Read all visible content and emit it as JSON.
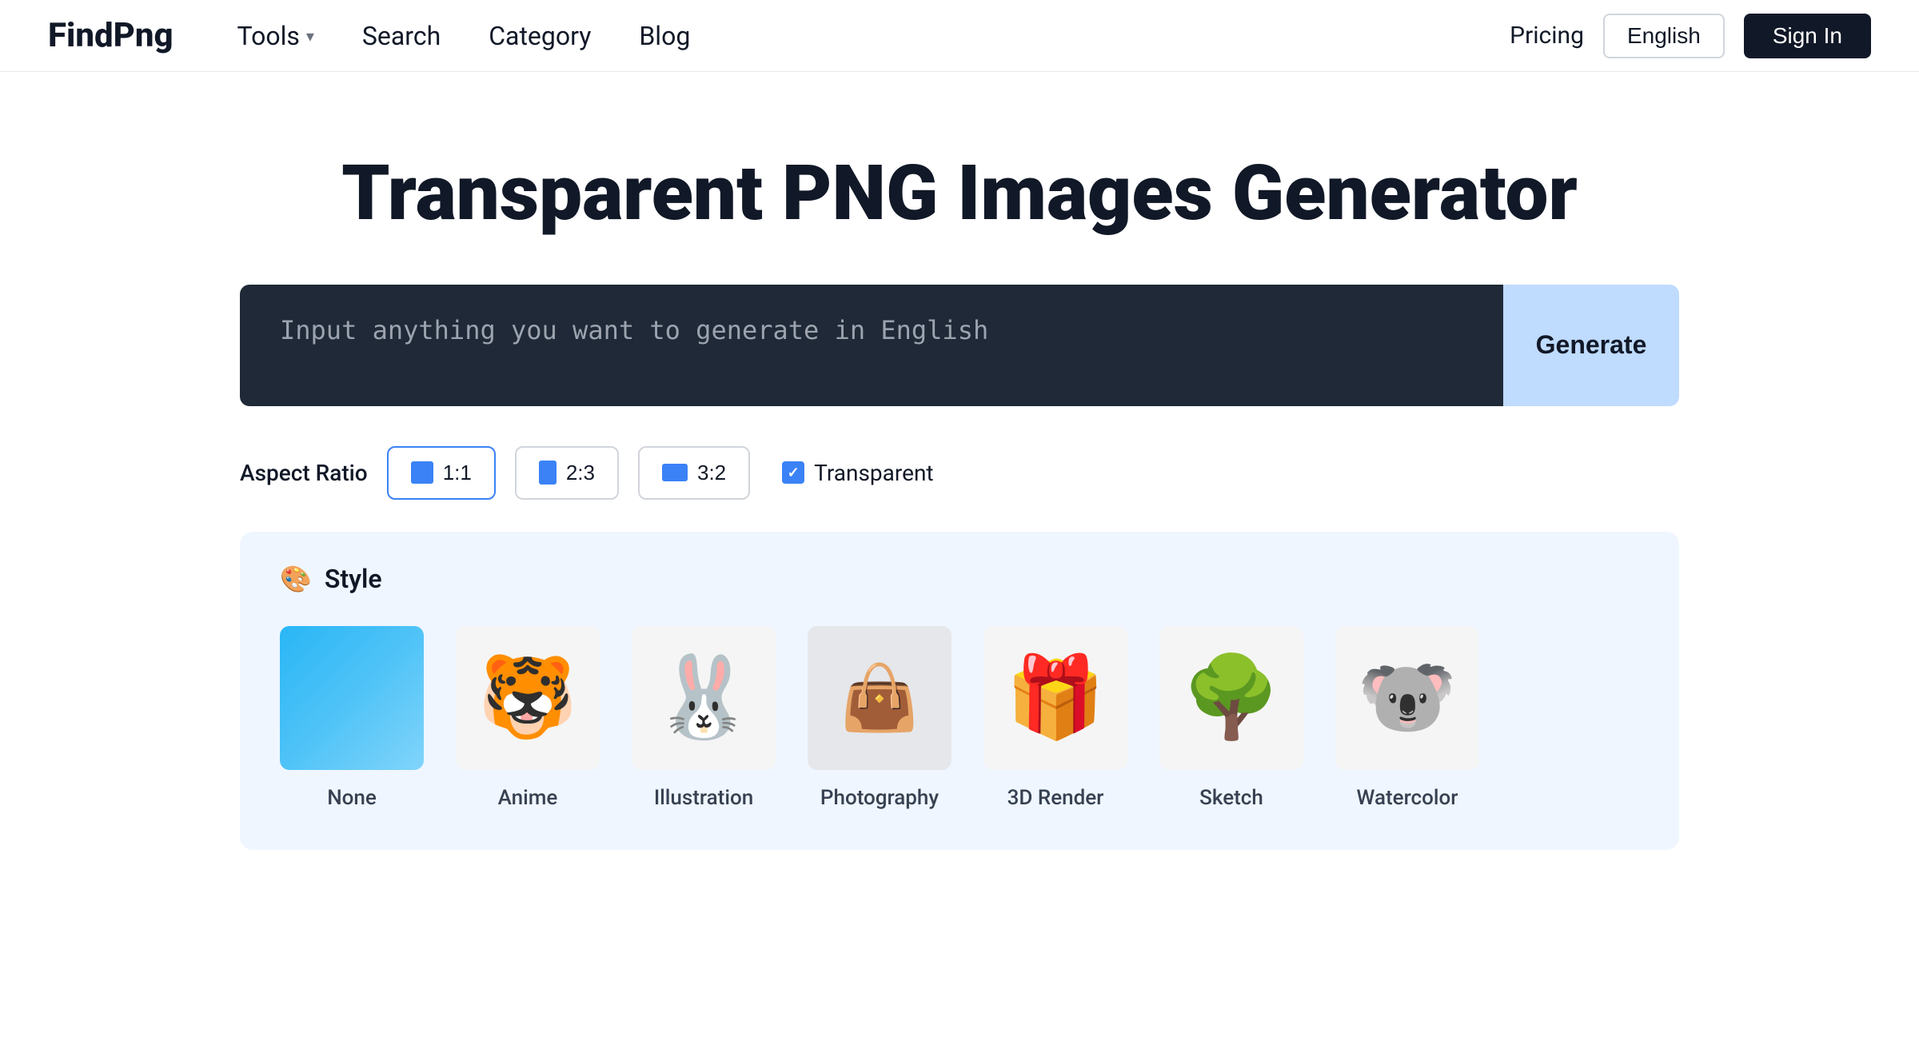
{
  "header": {
    "logo": "FindPng",
    "nav": [
      {
        "label": "Tools",
        "hasDropdown": true
      },
      {
        "label": "Search",
        "hasDropdown": false
      },
      {
        "label": "Category",
        "hasDropdown": false
      },
      {
        "label": "Blog",
        "hasDropdown": false
      }
    ],
    "pricing_label": "Pricing",
    "lang_label": "English",
    "signin_label": "Sign In"
  },
  "hero": {
    "title": "Transparent PNG Images Generator"
  },
  "search": {
    "placeholder": "Input anything you want to generate in English",
    "generate_label": "Generate"
  },
  "aspect_ratio": {
    "label": "Aspect Ratio",
    "options": [
      {
        "label": "1:1",
        "active": true
      },
      {
        "label": "2:3",
        "active": false
      },
      {
        "label": "3:2",
        "active": false
      }
    ],
    "transparent_label": "Transparent"
  },
  "style": {
    "section_title": "Style",
    "items": [
      {
        "label": "None",
        "icon": "none"
      },
      {
        "label": "Anime",
        "icon": "tiger"
      },
      {
        "label": "Illustration",
        "icon": "rabbit"
      },
      {
        "label": "Photography",
        "icon": "bag"
      },
      {
        "label": "3D Render",
        "icon": "gift"
      },
      {
        "label": "Sketch",
        "icon": "tree"
      },
      {
        "label": "Watercolor",
        "icon": "koala"
      }
    ]
  }
}
